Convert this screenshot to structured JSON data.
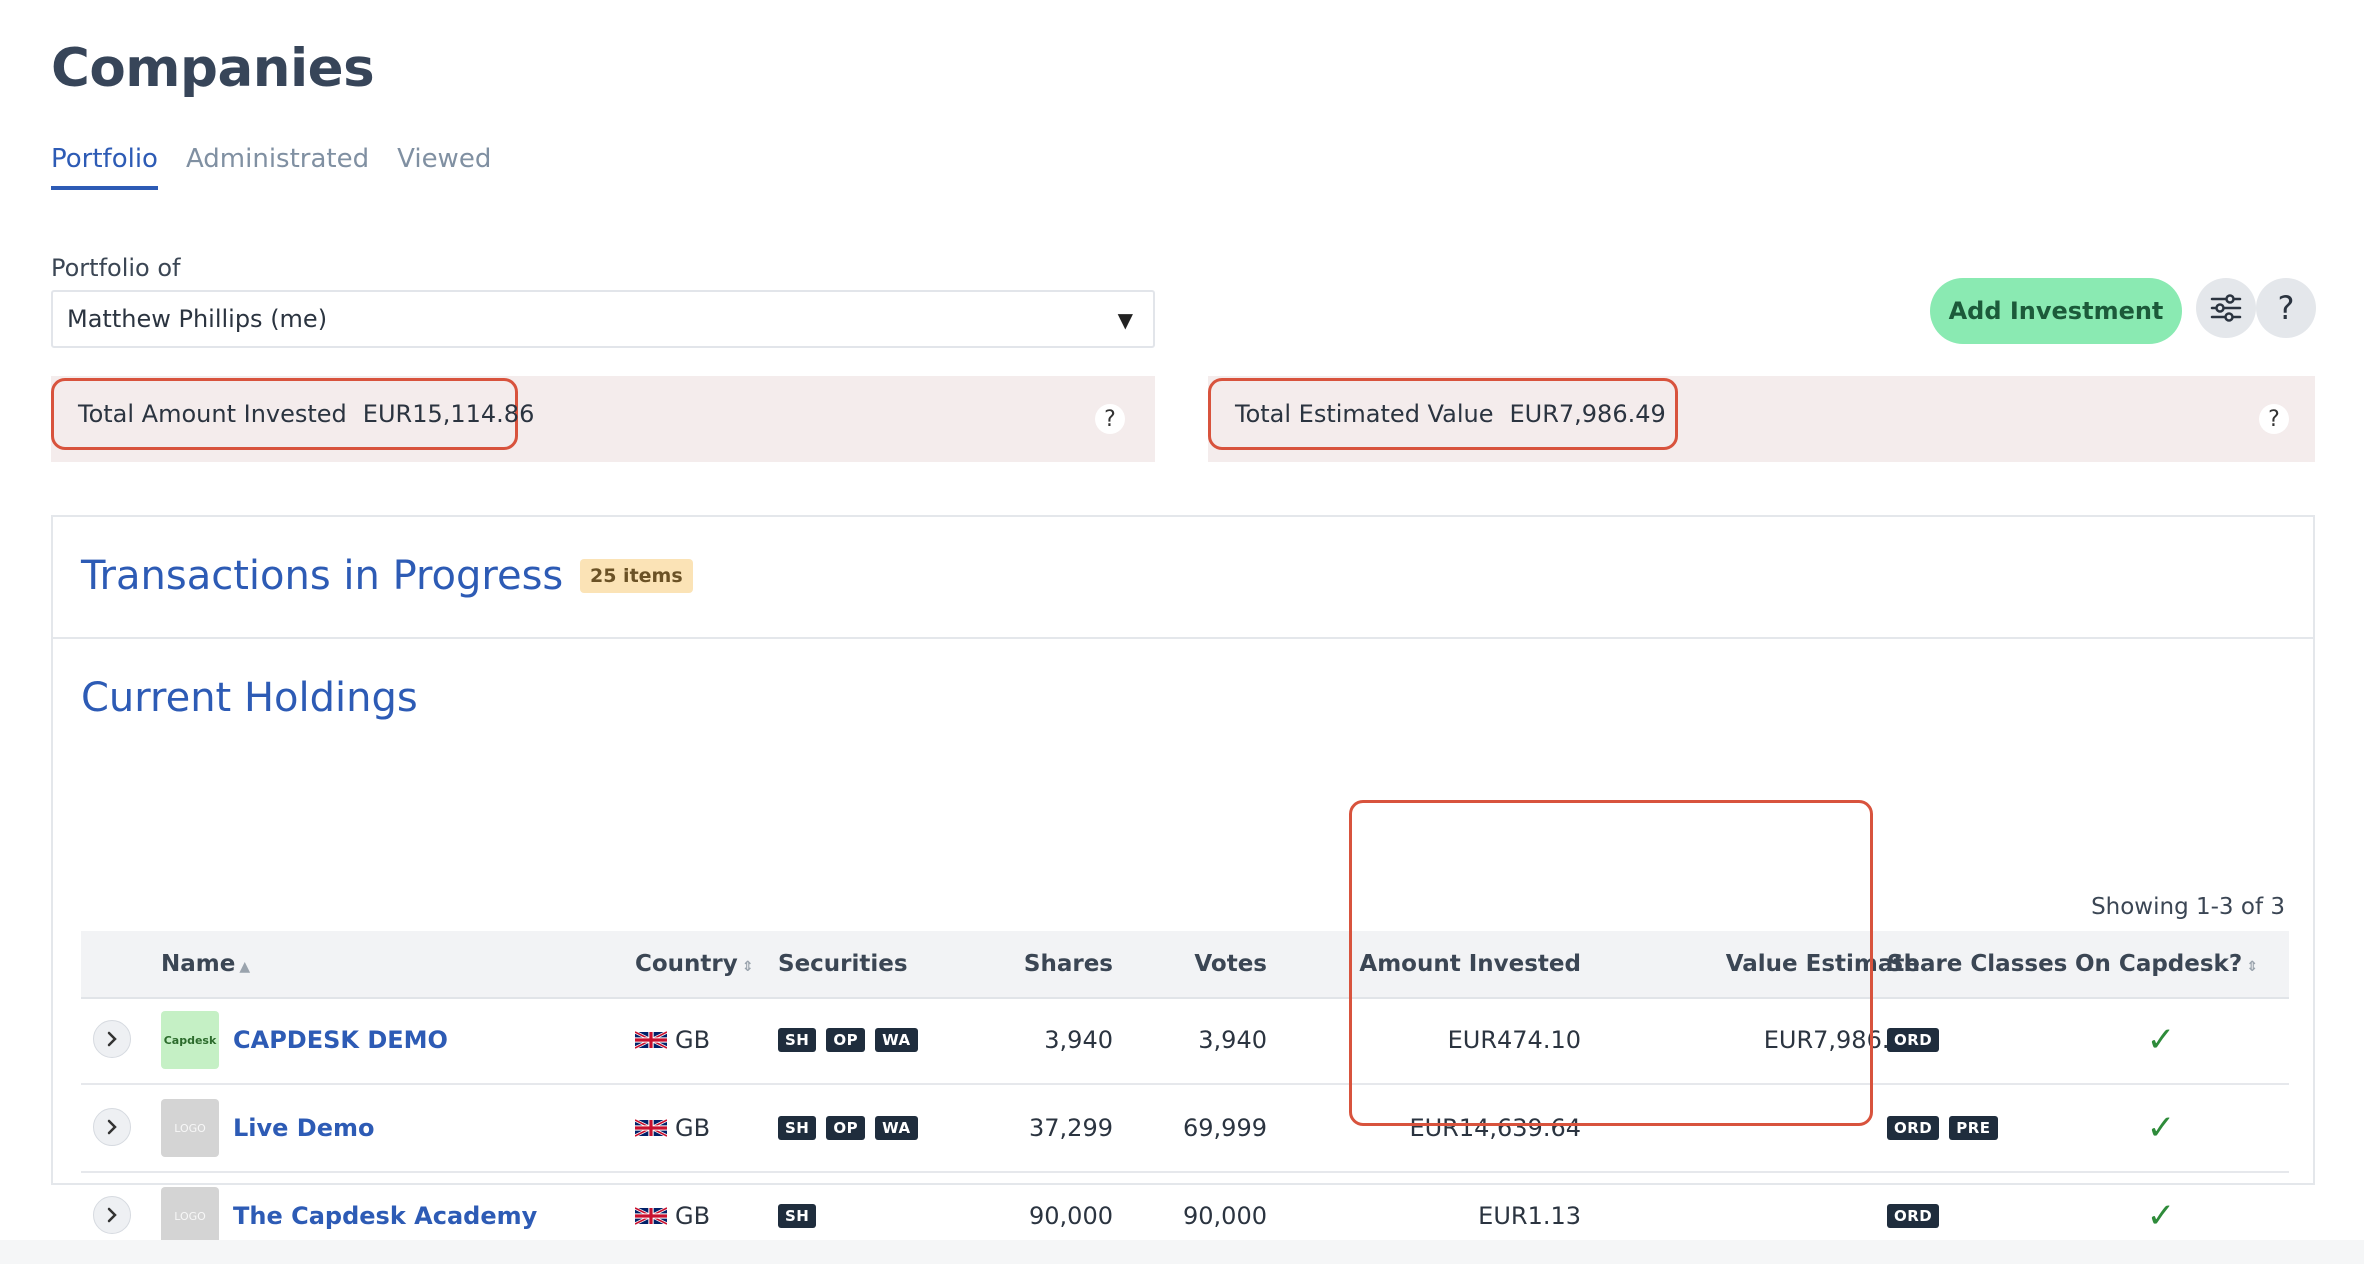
{
  "page": {
    "title": "Companies"
  },
  "tabs": [
    {
      "label": "Portfolio",
      "active": true
    },
    {
      "label": "Administrated",
      "active": false
    },
    {
      "label": "Viewed",
      "active": false
    }
  ],
  "portfolio_filter": {
    "label": "Portfolio of",
    "selected": "Matthew Phillips (me)"
  },
  "actions": {
    "add_investment": "Add Investment",
    "settings_icon": "sliders-icon",
    "help_icon": "question-icon",
    "help_glyph": "?"
  },
  "summary": {
    "invested_label": "Total Amount Invested",
    "invested_value": "EUR15,114.86",
    "estimated_label": "Total Estimated Value",
    "estimated_value": "EUR7,986.49",
    "help_glyph": "?"
  },
  "transactions": {
    "title": "Transactions in Progress",
    "count_badge": "25 items"
  },
  "holdings": {
    "title": "Current Holdings",
    "showing": "Showing 1-3 of 3",
    "columns": {
      "name": "Name",
      "country": "Country",
      "securities": "Securities",
      "shares": "Shares",
      "votes": "Votes",
      "amount_invested": "Amount Invested",
      "value_estimate": "Value Estimate",
      "share_classes": "Share Classes",
      "on_capdesk": "On Capdesk?"
    },
    "rows": [
      {
        "name": "CAPDESK DEMO",
        "logo_text": "Capdesk",
        "country": "GB",
        "securities": [
          "SH",
          "OP",
          "WA"
        ],
        "shares": "3,940",
        "votes": "3,940",
        "amount_invested": "EUR474.10",
        "value_estimate": "EUR7,986.49",
        "share_classes": [
          "ORD"
        ],
        "on_capdesk": "✓"
      },
      {
        "name": "Live Demo",
        "logo_text": "LOGO",
        "country": "GB",
        "securities": [
          "SH",
          "OP",
          "WA"
        ],
        "shares": "37,299",
        "votes": "69,999",
        "amount_invested": "EUR14,639.64",
        "value_estimate": "-",
        "share_classes": [
          "ORD",
          "PRE"
        ],
        "on_capdesk": "✓"
      },
      {
        "name": "The Capdesk Academy",
        "logo_text": "LOGO",
        "country": "GB",
        "securities": [
          "SH"
        ],
        "shares": "90,000",
        "votes": "90,000",
        "amount_invested": "EUR1.13",
        "value_estimate": "-",
        "share_classes": [
          "ORD"
        ],
        "on_capdesk": "✓"
      }
    ]
  },
  "colors": {
    "accent": "#2d5bb5",
    "add_button": "#8aeab2",
    "highlight": "#d8533d",
    "check": "#2e8b3a"
  }
}
